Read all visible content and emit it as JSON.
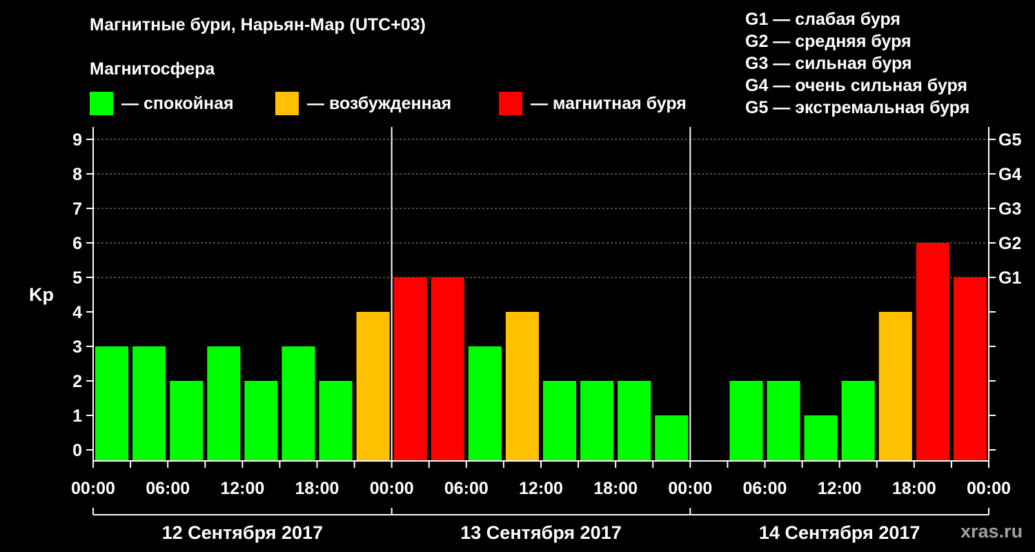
{
  "chart_data": {
    "type": "bar",
    "title": "Магнитные бури, Нарьян-Мар (UTC+03)",
    "subtitle": "Магнитосфера",
    "ylabel": "Kp",
    "ylim": [
      0,
      9
    ],
    "y_ticks": [
      "0",
      "1",
      "2",
      "3",
      "4",
      "5",
      "6",
      "7",
      "8",
      "9"
    ],
    "right_ticks": [
      {
        "kp": 5,
        "label": "G1"
      },
      {
        "kp": 6,
        "label": "G2"
      },
      {
        "kp": 7,
        "label": "G3"
      },
      {
        "kp": 8,
        "label": "G4"
      },
      {
        "kp": 9,
        "label": "G5"
      }
    ],
    "x_tick_labels": [
      "00:00",
      "06:00",
      "12:00",
      "18:00",
      "00:00",
      "06:00",
      "12:00",
      "18:00",
      "00:00",
      "06:00",
      "12:00",
      "18:00",
      "00:00"
    ],
    "days": [
      {
        "label": "12 Сентября 2017",
        "values": [
          3,
          3,
          2,
          3,
          2,
          3,
          2,
          4
        ]
      },
      {
        "label": "13 Сентября 2017",
        "values": [
          5,
          5,
          3,
          4,
          2,
          2,
          2,
          1
        ]
      },
      {
        "label": "14 Сентября 2017",
        "values": [
          null,
          2,
          2,
          1,
          2,
          4,
          6,
          5
        ]
      }
    ],
    "categories": [
      {
        "name": "— спокойная",
        "color": "#00ff00"
      },
      {
        "name": "— возбужденная",
        "color": "#ffc000"
      },
      {
        "name": "— магнитная буря",
        "color": "#ff0000"
      }
    ],
    "storm_levels": [
      "G1 — слабая буря",
      "G2 — средняя буря",
      "G3 — сильная буря",
      "G4 — очень сильная буря",
      "G5 — экстремальная буря"
    ],
    "grid": "dashed at Kp 5–9",
    "legend_position": "top"
  },
  "watermark": "xras.ru"
}
